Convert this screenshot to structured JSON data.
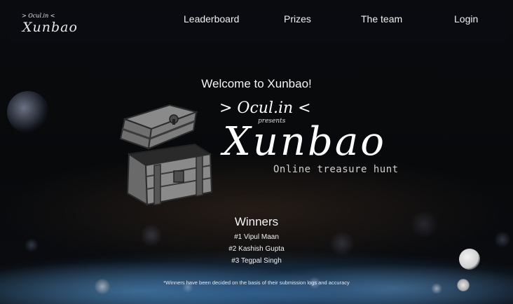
{
  "nav": {
    "logo_top": "> Ocul.in <",
    "logo_main": "Xunbao",
    "items": [
      {
        "label": "Leaderboard"
      },
      {
        "label": "Prizes"
      },
      {
        "label": "The team"
      },
      {
        "label": "Login"
      }
    ]
  },
  "hero": {
    "welcome": "Welcome to Xunbao!",
    "ocul": "> Ocul.in <",
    "presents": "presents",
    "title": "Xunbao",
    "subtitle": "Online treasure hunt",
    "chest_icon": "treasure-chest"
  },
  "winners": {
    "title": "Winners",
    "list": [
      "#1 Vipul Maan",
      "#2 Kashish Gupta",
      "#3 Tegpal Singh"
    ],
    "note": "*Winners have been decided on the basis of their submission logs and accuracy"
  }
}
